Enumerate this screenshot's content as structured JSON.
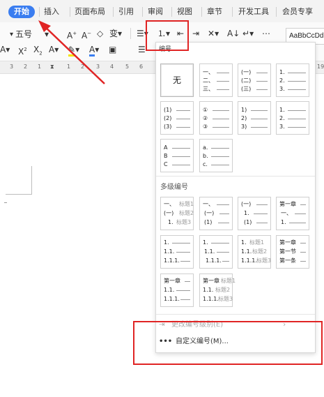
{
  "menu": {
    "tabs": [
      "开始",
      "插入",
      "页面布局",
      "引用",
      "审阅",
      "视图",
      "章节",
      "开发工具",
      "会员专享"
    ]
  },
  "ribbon": {
    "font_size": "五号",
    "style_preview": "AaBbCcDd"
  },
  "ruler": {
    "numbers": [
      "3",
      "2",
      "1",
      "1",
      "2",
      "3",
      "4",
      "5",
      "6",
      "7",
      "8",
      "9",
      "10",
      "19"
    ]
  },
  "panel": {
    "tooltip": "编号",
    "none_label": "无",
    "section_multilevel": "多级编号",
    "rows_single": [
      [
        [
          "一、",
          "二、",
          "三、"
        ],
        [
          "(一)",
          "(二)",
          "(三)"
        ],
        [
          "1.",
          "2.",
          "3."
        ]
      ],
      [
        [
          "(1)",
          "(2)",
          "(3)"
        ],
        [
          "①",
          "②",
          "③"
        ],
        [
          "1)",
          "2)",
          "3)"
        ],
        [
          "1.",
          "2.",
          "3."
        ]
      ],
      [
        [
          "A",
          "B",
          "C"
        ],
        [
          "a.",
          "b.",
          "c."
        ]
      ]
    ],
    "rows_multi": [
      [
        [
          [
            "一、",
            "标题1"
          ],
          [
            "(一)",
            "标题2"
          ],
          [
            "1.",
            "标题3"
          ]
        ],
        [
          [
            "一、",
            ""
          ],
          [
            "(一)",
            ""
          ],
          [
            "(1)",
            ""
          ]
        ],
        [
          [
            "(一)",
            ""
          ],
          [
            "1.",
            ""
          ],
          [
            "(1)",
            ""
          ]
        ],
        [
          [
            "第一章",
            ""
          ],
          [
            "一、",
            ""
          ],
          [
            "1.",
            ""
          ]
        ]
      ],
      [
        [
          [
            "1.",
            ""
          ],
          [
            "1.1.",
            ""
          ],
          [
            "1.1.1.",
            ""
          ]
        ],
        [
          [
            "1.",
            ""
          ],
          [
            "1.1.",
            ""
          ],
          [
            "1.1.1.",
            ""
          ]
        ],
        [
          [
            "1.",
            "标题1"
          ],
          [
            "1.1.",
            "标题2"
          ],
          [
            "1.1.1.",
            "标题3"
          ]
        ],
        [
          [
            "第一章",
            ""
          ],
          [
            "第一节",
            ""
          ],
          [
            "第一条",
            ""
          ]
        ]
      ],
      [
        [
          [
            "第一章",
            ""
          ],
          [
            "1.1.",
            ""
          ],
          [
            "1.1.1.",
            ""
          ]
        ],
        [
          [
            "第一章",
            "标题1"
          ],
          [
            "1.1.",
            "标题2"
          ],
          [
            "1.1.1.",
            "标题3"
          ]
        ]
      ]
    ],
    "change_level": "更改编号级别(E)",
    "custom": "自定义编号(M)..."
  },
  "colors": {
    "accent": "#3a7df0",
    "annotation_red": "#e02424"
  }
}
